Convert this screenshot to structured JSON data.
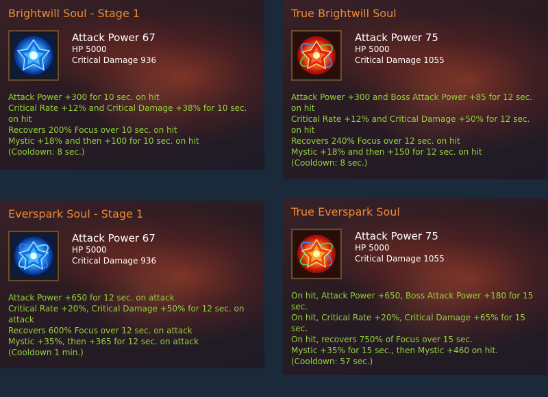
{
  "cards": [
    {
      "title": "Brightwill Soul - Stage 1",
      "icon": "blue-gem-icon",
      "stats": {
        "main": "Attack Power 67",
        "hp": "HP 5000",
        "crit": "Critical Damage 936"
      },
      "effects": [
        "Attack Power +300 for 10 sec. on hit",
        "Critical Rate +12% and Critical Damage +38% for 10 sec. on hit",
        "Recovers 200% Focus over 10 sec. on hit",
        "Mystic +18% and then +100 for 10 sec. on hit",
        "(Cooldown: 8 sec.)"
      ]
    },
    {
      "title": "True Brightwill Soul",
      "icon": "red-gem-icon",
      "stats": {
        "main": "Attack Power 75",
        "hp": "HP 5000",
        "crit": "Critical Damage 1055"
      },
      "effects": [
        "Attack Power +300 and Boss Attack Power +85 for 12 sec. on hit",
        "Critical Rate +12% and Critical Damage +50% for 12 sec. on hit",
        "Recovers 240% Focus over 12 sec. on hit",
        "Mystic +18% and then +150 for 12 sec. on hit",
        "(Cooldown: 8 sec.)"
      ]
    },
    {
      "title": "Everspark Soul - Stage 1",
      "icon": "blue-gem-icon",
      "stats": {
        "main": "Attack Power 67",
        "hp": "HP 5000",
        "crit": "Critical Damage 936"
      },
      "effects": [
        "Attack Power +650 for 12 sec. on attack",
        "Critical Rate +20%, Critical Damage +50% for 12 sec. on attack",
        "Recovers 600% Focus over 12 sec. on attack",
        "Mystic +35%, then +365 for 12 sec. on attack",
        "(Cooldown 1 min.)"
      ]
    },
    {
      "title": "True Everspark Soul",
      "icon": "red-gem-icon",
      "stats": {
        "main": "Attack Power 75",
        "hp": "HP 5000",
        "crit": "Critical Damage 1055"
      },
      "effects": [
        "On hit, Attack Power +650, Boss Attack Power +180 for 15 sec.",
        "On hit, Critical Rate +20%, Critical Damage +65% for 15 sec.",
        "On hit, recovers 750% of Focus over 15 sec.",
        "Mystic +35% for 15 sec., then Mystic +460 on hit.",
        "(Cooldown: 57 sec.)"
      ]
    }
  ],
  "colors": {
    "title": "#f08a35",
    "stats": "#ffffff",
    "effects": "#93d23e",
    "background": "#1b2a3b"
  }
}
